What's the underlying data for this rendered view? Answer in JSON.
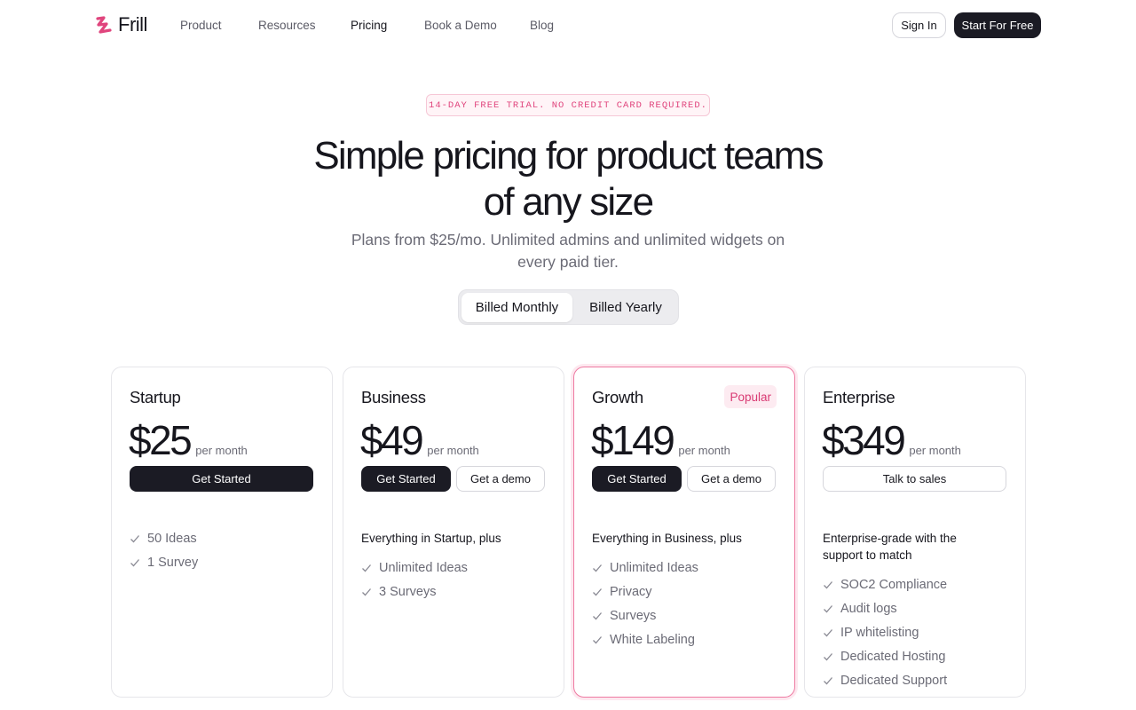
{
  "brand": {
    "name": "Frill",
    "accent": "#e0457d"
  },
  "nav": {
    "links": [
      "Product",
      "Resources",
      "Pricing",
      "Book a Demo",
      "Blog"
    ],
    "active": "Pricing",
    "sign_in": "Sign In",
    "start_free": "Start For Free"
  },
  "hero": {
    "badge": "14-DAY FREE TRIAL. NO CREDIT CARD REQUIRED.",
    "title": "Simple pricing for product teams of any size",
    "subtitle": "Plans from $25/mo. Unlimited admins and unlimited widgets on every paid tier."
  },
  "billing_toggle": {
    "monthly": "Billed Monthly",
    "yearly": "Billed Yearly",
    "selected": "Billed Monthly"
  },
  "plans": [
    {
      "name": "Startup",
      "price": "$25",
      "period": "per month",
      "primary_button": "Get Started",
      "intro": "",
      "features": [
        "50 Ideas",
        "1 Survey"
      ]
    },
    {
      "name": "Business",
      "price": "$49",
      "period": "per month",
      "primary_button": "Get Started",
      "secondary_button": "Get a demo",
      "intro": "Everything in Startup, plus",
      "features": [
        "Unlimited Ideas",
        "3 Surveys"
      ]
    },
    {
      "name": "Growth",
      "badge": "Popular",
      "price": "$149",
      "period": "per month",
      "primary_button": "Get Started",
      "secondary_button": "Get a demo",
      "intro": "Everything in Business, plus",
      "features": [
        "Unlimited Ideas",
        "Privacy",
        "Surveys",
        "White Labeling"
      ]
    },
    {
      "name": "Enterprise",
      "price": "$349",
      "period": "per month",
      "secondary_button": "Talk to sales",
      "intro": "Enterprise-grade with the support to match",
      "features": [
        "SOC2 Compliance",
        "Audit logs",
        "IP whitelisting",
        "Dedicated Hosting",
        "Dedicated Support"
      ]
    }
  ],
  "icons": {
    "feature": "check-icon",
    "logo": "frill-logo-icon"
  }
}
